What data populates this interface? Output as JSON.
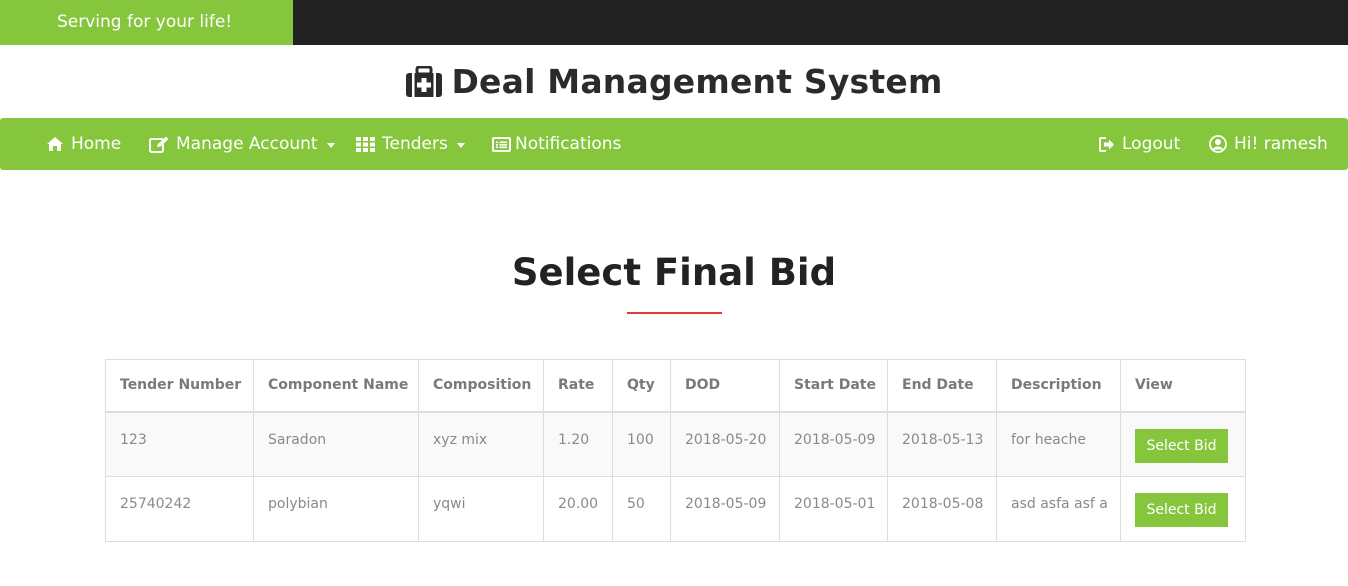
{
  "topbar": {
    "tagline": "Serving for your life!"
  },
  "brand": {
    "title": "Deal Management System",
    "icon": "medkit-icon"
  },
  "nav": {
    "home": "Home",
    "manage_account": "Manage Account",
    "tenders": "Tenders",
    "notifications": "Notifications",
    "logout": "Logout",
    "user": "Hi! ramesh"
  },
  "page": {
    "title": "Select Final Bid"
  },
  "table": {
    "headers": [
      "Tender Number",
      "Component Name",
      "Composition",
      "Rate",
      "Qty",
      "DOD",
      "Start Date",
      "End Date",
      "Description",
      "View"
    ],
    "rows": [
      {
        "tender_number": "123",
        "component_name": "Saradon",
        "composition": "xyz mix",
        "rate": "1.20",
        "qty": "100",
        "dod": "2018-05-20",
        "start_date": "2018-05-09",
        "end_date": "2018-05-13",
        "description": "for heache",
        "action": "Select Bid"
      },
      {
        "tender_number": "25740242",
        "component_name": "polybian",
        "composition": "yqwi",
        "rate": "20.00",
        "qty": "50",
        "dod": "2018-05-09",
        "start_date": "2018-05-01",
        "end_date": "2018-05-08",
        "description": "asd asfa asf a",
        "action": "Select Bid"
      }
    ]
  },
  "colors": {
    "accent": "#85c63d",
    "topbar": "#222222",
    "underline": "#e53935"
  }
}
